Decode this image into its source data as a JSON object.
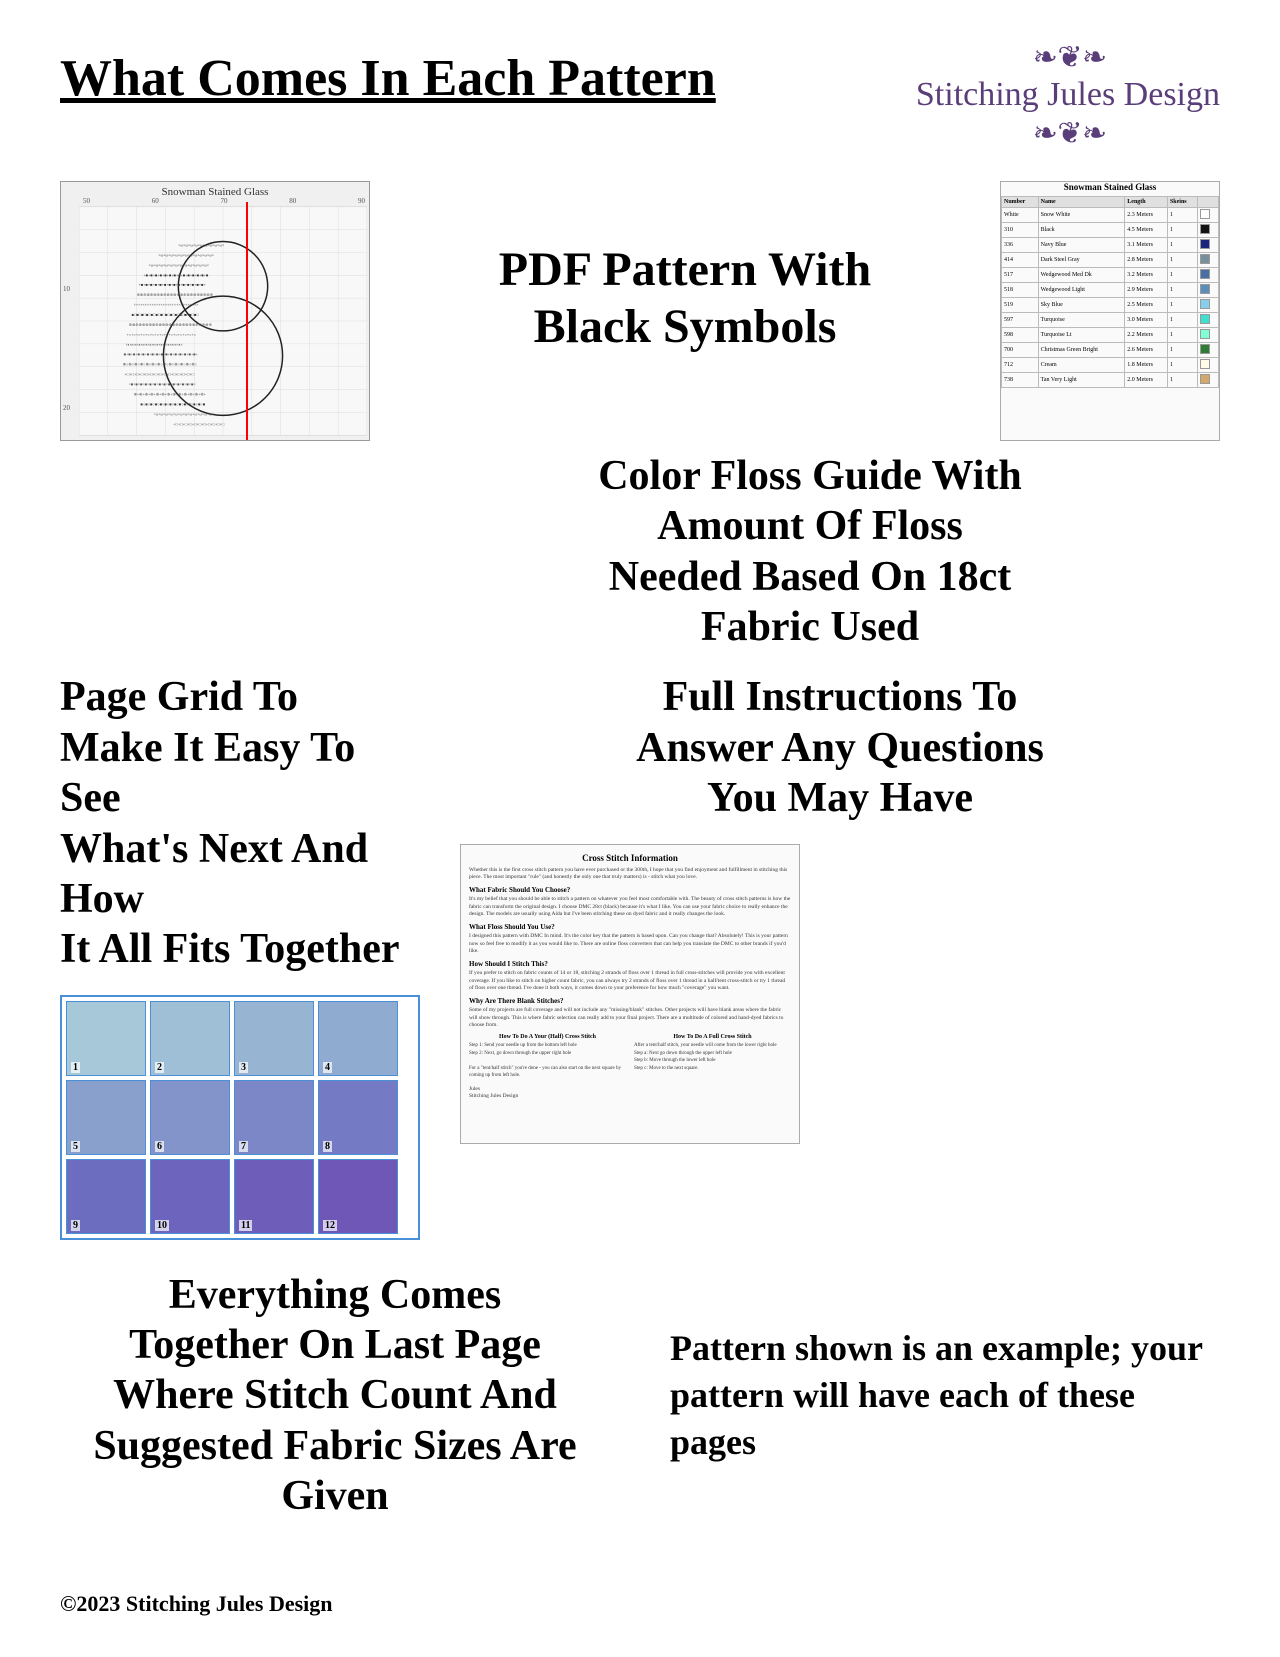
{
  "header": {
    "title": "What Comes In Each Pattern",
    "logo_line1": "Stitching Jules Design"
  },
  "sections": {
    "pdf_pattern": {
      "label_line1": "PDF Pattern With",
      "label_line2": "Black Symbols",
      "pattern_caption": "Snowman Stained Glass"
    },
    "color_floss": {
      "label_line1": "Color Floss Guide With",
      "label_line2": "Amount Of Floss",
      "label_line3": "Needed Based On 18ct",
      "label_line4": "Fabric Used",
      "table_caption": "Snowman Stained Glass"
    },
    "page_grid": {
      "label_line1": "Page Grid To",
      "label_line2": "Make It Easy To See",
      "label_line3": "What's Next And How",
      "label_line4": "It All Fits Together"
    },
    "instructions": {
      "label_line1": "Full Instructions To",
      "label_line2": "Answer Any Questions",
      "label_line3": "You May Have",
      "doc_title": "Cross Stitch Information",
      "doc_section": "How To Do A Your (Half) Cross Stitch",
      "doc_section2": "How To Do A Full Cross Stitch"
    },
    "everything": {
      "label_line1": "Everything Comes",
      "label_line2": "Together On Last Page",
      "label_line3": "Where Stitch Count And",
      "label_line4": "Suggested Fabric Sizes Are",
      "label_line5": "Given"
    },
    "pattern_note": {
      "text": "Pattern shown is an example; your pattern will have each of these pages"
    }
  },
  "footer": {
    "text": "©2023 Stitching Jules Design"
  },
  "floss_table": {
    "headers": [
      "Number",
      "Name",
      "Length",
      "Skeins"
    ],
    "rows": [
      {
        "number": "White",
        "name": "Snow White",
        "length": "2.3 Meters",
        "skeins": "1",
        "color": "#ffffff"
      },
      {
        "number": "310",
        "name": "Black",
        "length": "4.5 Meters",
        "skeins": "1",
        "color": "#111111"
      },
      {
        "number": "336",
        "name": "Navy Blue",
        "length": "3.1 Meters",
        "skeins": "1",
        "color": "#1a237e"
      },
      {
        "number": "414",
        "name": "Dark Steel Gray",
        "length": "2.8 Meters",
        "skeins": "1",
        "color": "#78909c"
      },
      {
        "number": "517",
        "name": "Wedgewood Med Dk",
        "length": "3.2 Meters",
        "skeins": "1",
        "color": "#4a6fa5"
      },
      {
        "number": "518",
        "name": "Wedgewood Light",
        "length": "2.9 Meters",
        "skeins": "1",
        "color": "#5b8db8"
      },
      {
        "number": "519",
        "name": "Sky Blue",
        "length": "2.5 Meters",
        "skeins": "1",
        "color": "#87ceeb"
      },
      {
        "number": "597",
        "name": "Turquoise",
        "length": "3.0 Meters",
        "skeins": "1",
        "color": "#40e0d0"
      },
      {
        "number": "598",
        "name": "Turquoise Lt",
        "length": "2.2 Meters",
        "skeins": "1",
        "color": "#7fffd4"
      },
      {
        "number": "700",
        "name": "Christmas Green Bright",
        "length": "2.6 Meters",
        "skeins": "1",
        "color": "#2e7d32"
      },
      {
        "number": "712",
        "name": "Cream",
        "length": "1.8 Meters",
        "skeins": "1",
        "color": "#fffde7"
      },
      {
        "number": "738",
        "name": "Tan Very Light",
        "length": "2.0 Meters",
        "skeins": "1",
        "color": "#d4a76a"
      }
    ]
  },
  "thumb_numbers": [
    "1",
    "2",
    "3",
    "4",
    "5",
    "6",
    "7",
    "8",
    "9",
    "10",
    "11",
    "12"
  ],
  "accent_color": "#4a90d9",
  "logo_color": "#5a3e7a"
}
